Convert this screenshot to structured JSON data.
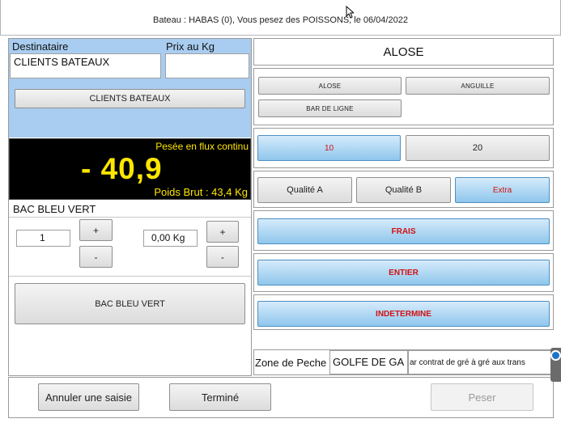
{
  "header": {
    "title": "Bateau : HABAS (0), Vous pesez des POISSONS, le 06/04/2022"
  },
  "left": {
    "destinataire_label": "Destinataire",
    "prix_label": "Prix au Kg",
    "destinataire_value": "CLIENTS BATEAUX",
    "prix_value": "",
    "client_button": "CLIENTS BATEAUX",
    "scale": {
      "mode": "Pesée en flux continu",
      "net": "- 40,9",
      "brut": "Poids Brut : 43,4 Kg"
    },
    "bac_label": "BAC BLEU VERT",
    "qty_value": "1",
    "weight_value": "0,00 Kg",
    "plus": "+",
    "minus": "-",
    "bac_button": "BAC BLEU VERT"
  },
  "right": {
    "species_title": "ALOSE",
    "species": [
      "ALOSE",
      "ANGUILLE",
      "BAR DE LIGNE"
    ],
    "sizes": [
      "10",
      "20"
    ],
    "qualities": [
      "Qualité A",
      "Qualité B",
      "Extra"
    ],
    "presentation": "FRAIS",
    "state": "ENTIER",
    "sex": "INDETERMINE",
    "zone_label": "Zone de Peche",
    "zone_value": "GOLFE DE GA",
    "contract_value": "ar contrat de gré à gré aux trans"
  },
  "footer": {
    "cancel": "Annuler une saisie",
    "done": "Terminé",
    "weigh": "Peser"
  },
  "colors": {
    "selected": "#8fc6ec",
    "scale_text": "#ffe600",
    "highlight_text": "#d31010"
  }
}
